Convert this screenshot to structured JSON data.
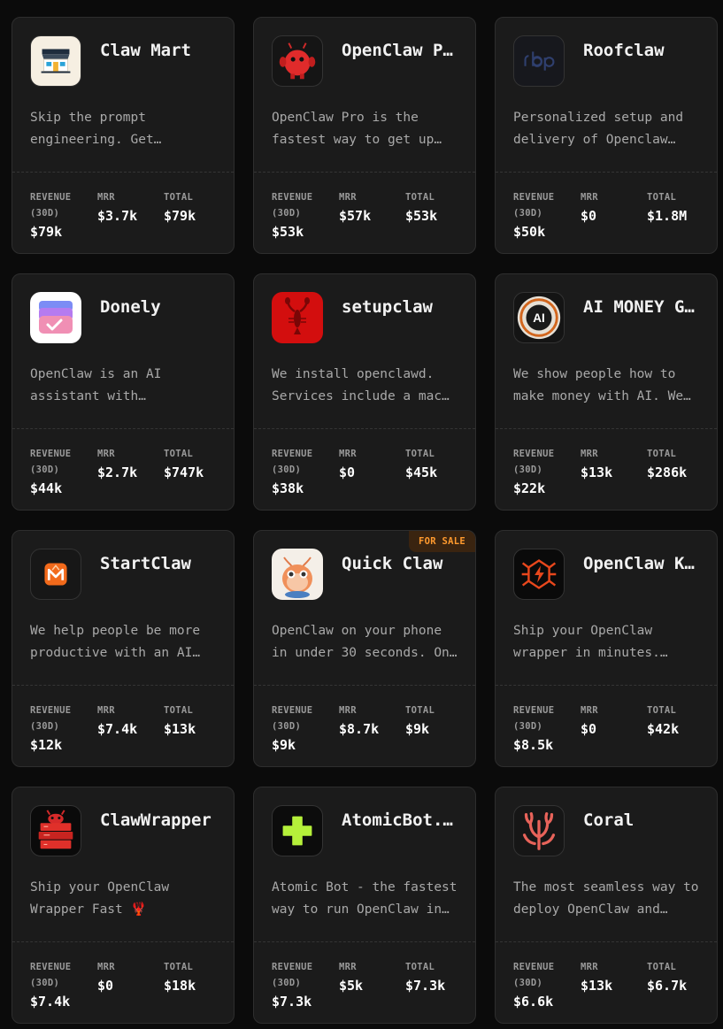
{
  "labels": {
    "revenue": "REVENUE",
    "revenue_period": "(30D)",
    "mrr": "MRR",
    "total": "TOTAL",
    "for_sale": "FOR SALE"
  },
  "cards": [
    {
      "name": "Claw Mart",
      "desc": [
        "Skip the prompt",
        "engineering. Get…"
      ],
      "revenue": "$79k",
      "mrr": "$3.7k",
      "total": "$79k",
      "logo": "storefront-icon",
      "for_sale": false
    },
    {
      "name": "OpenClaw P…",
      "desc": [
        "OpenClaw Pro is the",
        "fastest way to get up…"
      ],
      "revenue": "$53k",
      "mrr": "$57k",
      "total": "$53k",
      "logo": "red-monster-icon",
      "for_sale": false
    },
    {
      "name": "Roofclaw",
      "desc": [
        "Personalized setup and",
        "delivery of Openclaw…"
      ],
      "revenue": "$50k",
      "mrr": "$0",
      "total": "$1.8M",
      "logo": "rbp-logo-icon",
      "for_sale": false
    },
    {
      "name": "Donely",
      "desc": [
        "OpenClaw is an AI",
        "assistant with…"
      ],
      "revenue": "$44k",
      "mrr": "$2.7k",
      "total": "$747k",
      "logo": "layers-check-icon",
      "for_sale": false
    },
    {
      "name": "setupclaw",
      "desc": [
        "We install openclawd.",
        "Services include a mac…"
      ],
      "revenue": "$38k",
      "mrr": "$0",
      "total": "$45k",
      "logo": "lobster-icon",
      "for_sale": false
    },
    {
      "name": "AI MONEY G…",
      "desc": [
        "We show people how to",
        "make money with AI. We…"
      ],
      "revenue": "$22k",
      "mrr": "$13k",
      "total": "$286k",
      "logo": "ai-badge-icon",
      "for_sale": false
    },
    {
      "name": "StartClaw",
      "desc": [
        "We help people be more",
        "productive with an AI…"
      ],
      "revenue": "$12k",
      "mrr": "$7.4k",
      "total": "$13k",
      "logo": "m-flame-icon",
      "for_sale": false
    },
    {
      "name": "Quick Claw",
      "desc": [
        "OpenClaw on your phone",
        "in under 30 seconds. On…"
      ],
      "revenue": "$9k",
      "mrr": "$8.7k",
      "total": "$9k",
      "logo": "shrimp-mascot-icon",
      "for_sale": true
    },
    {
      "name": "OpenClaw K…",
      "desc": [
        "Ship your OpenClaw",
        "wrapper in minutes.…"
      ],
      "revenue": "$8.5k",
      "mrr": "$0",
      "total": "$42k",
      "logo": "spider-bolt-icon",
      "for_sale": false
    },
    {
      "name": "ClawWrapper",
      "desc": [
        "Ship your OpenClaw",
        "Wrapper Fast 🦞"
      ],
      "revenue": "$7.4k",
      "mrr": "$0",
      "total": "$18k",
      "logo": "red-box-monster-icon",
      "for_sale": false
    },
    {
      "name": "AtomicBot.…",
      "desc": [
        "Atomic Bot - the fastest",
        "way to run OpenClaw in…"
      ],
      "revenue": "$7.3k",
      "mrr": "$5k",
      "total": "$7.3k",
      "logo": "green-plus-icon",
      "for_sale": false
    },
    {
      "name": "Coral",
      "desc": [
        "The most seamless way to",
        "deploy OpenClaw and…"
      ],
      "revenue": "$6.6k",
      "mrr": "$13k",
      "total": "$6.7k",
      "logo": "coral-icon",
      "for_sale": false
    }
  ]
}
